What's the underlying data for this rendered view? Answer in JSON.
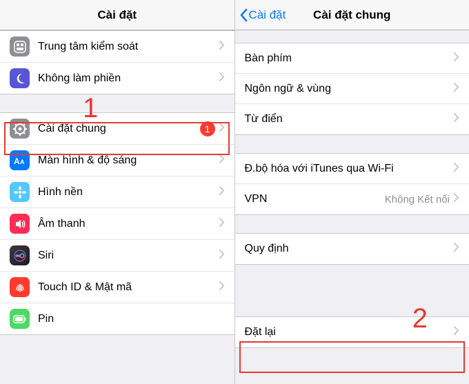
{
  "left": {
    "title": "Cài đặt",
    "group1": [
      {
        "name": "control-center",
        "label": "Trung tâm kiểm soát"
      },
      {
        "name": "do-not-disturb",
        "label": "Không làm phiền"
      }
    ],
    "group2": [
      {
        "name": "general",
        "label": "Cài đặt chung",
        "badge": "1"
      },
      {
        "name": "display",
        "label": "Màn hình & độ sáng"
      },
      {
        "name": "wallpaper",
        "label": "Hình nền"
      },
      {
        "name": "sounds",
        "label": "Âm thanh"
      },
      {
        "name": "siri",
        "label": "Siri"
      },
      {
        "name": "touchid",
        "label": "Touch ID & Mật mã"
      },
      {
        "name": "pin",
        "label": "Pin"
      }
    ],
    "annotation": "1"
  },
  "right": {
    "back": "Cài đặt",
    "title": "Cài đặt chung",
    "group1": [
      {
        "name": "keyboard",
        "label": "Bàn phím"
      },
      {
        "name": "language",
        "label": "Ngôn ngữ & vùng"
      },
      {
        "name": "dictionary",
        "label": "Từ điển"
      }
    ],
    "group2": [
      {
        "name": "itunes-wifi",
        "label": "Đ.bộ hóa với iTunes qua Wi-Fi"
      },
      {
        "name": "vpn",
        "label": "VPN",
        "value": "Không Kết nối"
      }
    ],
    "group3": [
      {
        "name": "regulatory",
        "label": "Quy định"
      }
    ],
    "group4": [
      {
        "name": "reset",
        "label": "Đặt lại"
      }
    ],
    "annotation": "2"
  }
}
